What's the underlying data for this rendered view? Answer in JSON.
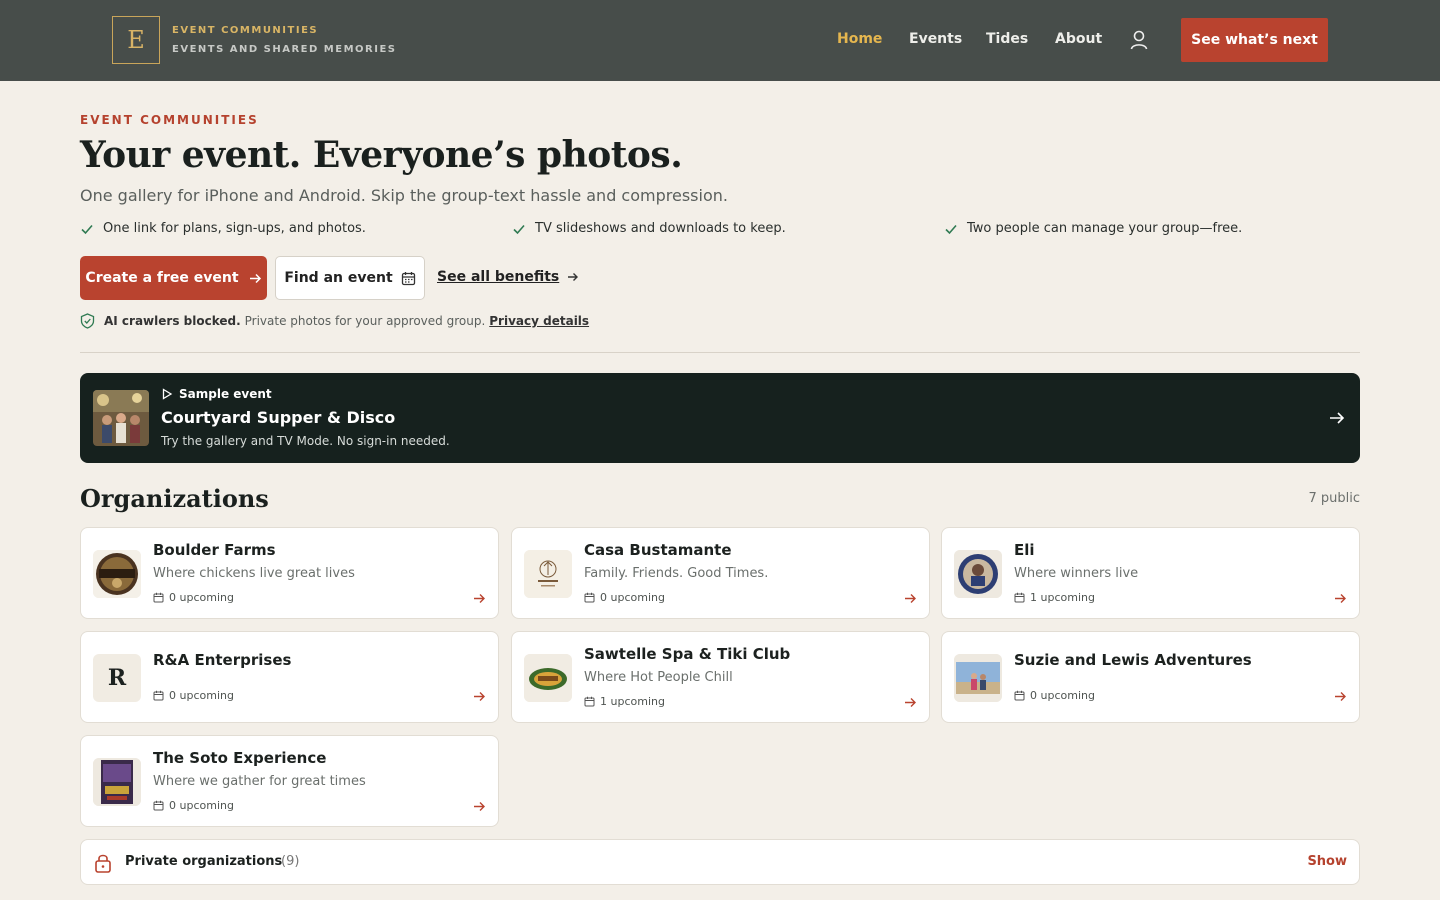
{
  "header": {
    "logo_letter": "E",
    "brand_name": "EVENT COMMUNITIES",
    "brand_tagline": "EVENTS AND SHARED MEMORIES",
    "nav": [
      "Home",
      "Events",
      "Tides",
      "About"
    ],
    "cta": "See what’s next"
  },
  "hero": {
    "eyebrow": "EVENT COMMUNITIES",
    "title": "Your event. Everyone’s photos.",
    "subtitle": "One gallery for iPhone and Android. Skip the group-text hassle and compression.",
    "checks": [
      "One link for plans, sign-ups, and photos.",
      "TV slideshows and downloads to keep.",
      "Two people can manage your group—free."
    ],
    "primary_button": "Create a free event",
    "secondary_button": "Find an event",
    "benefits_link": "See all benefits",
    "privacy_bold": "AI crawlers blocked.",
    "privacy_text": "Private photos for your approved group.",
    "privacy_link": "Privacy details"
  },
  "sample_event": {
    "tag": "Sample event",
    "title": "Courtyard Supper & Disco",
    "description": "Try the gallery and TV Mode. No sign-in needed."
  },
  "organizations": {
    "heading": "Organizations",
    "count_label": "7 public",
    "items": [
      {
        "name": "Boulder Farms",
        "tagline": "Where chickens live great lives",
        "upcoming": "0 upcoming"
      },
      {
        "name": "Casa Bustamante",
        "tagline": "Family. Friends. Good Times.",
        "upcoming": "0 upcoming"
      },
      {
        "name": "Eli",
        "tagline": "Where winners live",
        "upcoming": "1 upcoming"
      },
      {
        "name": "R&A Enterprises",
        "tagline": "",
        "upcoming": "0 upcoming",
        "initial": "R"
      },
      {
        "name": "Sawtelle Spa & Tiki Club",
        "tagline": "Where Hot People Chill",
        "upcoming": "1 upcoming"
      },
      {
        "name": "Suzie and Lewis Adventures",
        "tagline": "",
        "upcoming": "0 upcoming"
      },
      {
        "name": "The Soto Experience",
        "tagline": "Where we gather for great times",
        "upcoming": "0 upcoming"
      }
    ],
    "private_label": "Private organizations",
    "private_count": "(9)",
    "private_action": "Show"
  },
  "colors": {
    "header_bg": "#474d4a",
    "accent": "#b9432f",
    "nav_active": "#e5b64f",
    "page_bg": "#f3efe8",
    "banner_bg": "#16211e"
  }
}
